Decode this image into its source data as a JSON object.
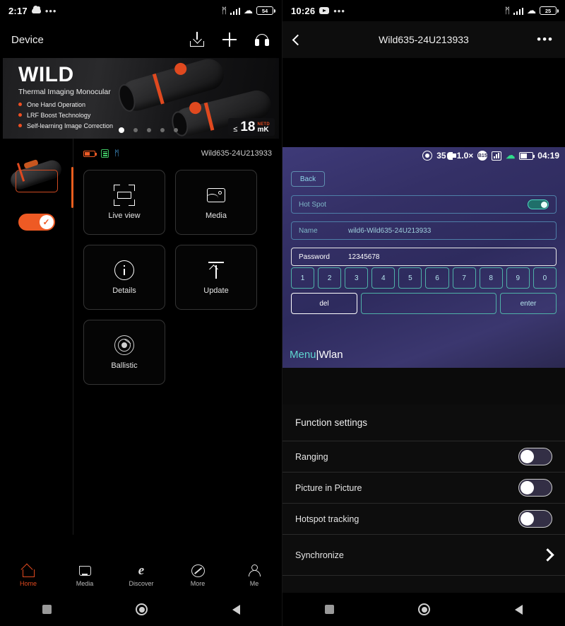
{
  "left": {
    "status": {
      "time": "2:17",
      "cloud_icon": "cloud-icon",
      "dots": "•••",
      "bluetooth": "ᛗ",
      "wifi": "◠",
      "battery": "54"
    },
    "header": {
      "title": "Device",
      "download_label": "download-icon",
      "add_label": "plus-icon",
      "support_label": "headset-icon"
    },
    "banner": {
      "title": "WILD",
      "subtitle": "Thermal Imaging Monocular",
      "features": [
        "One Hand Operation",
        "LRF Boost Technology",
        "Self-learning Image Correction"
      ],
      "netd_le": "≤",
      "netd_value": "18",
      "netd_unit_top": "NETD",
      "netd_unit": "mK",
      "dot_count": 5,
      "active_dot": 0
    },
    "device": {
      "id": "Wild635-24U213933",
      "battery_icon": "battery-icon",
      "storage_icon": "sd-card-icon",
      "bluetooth_icon": "bluetooth-icon",
      "toggle_on": true
    },
    "cards": [
      {
        "label": "Live view",
        "icon": "live-view-icon"
      },
      {
        "label": "Media",
        "icon": "media-icon"
      },
      {
        "label": "Details",
        "icon": "info-icon"
      },
      {
        "label": "Update",
        "icon": "upload-icon"
      },
      {
        "label": "Ballistic",
        "icon": "radar-icon"
      }
    ],
    "tabs": [
      {
        "label": "Home",
        "icon": "home-icon",
        "active": true
      },
      {
        "label": "Media",
        "icon": "folder-icon",
        "active": false
      },
      {
        "label": "Discover",
        "icon": "compass-icon",
        "active": false
      },
      {
        "label": "More",
        "icon": "slash-circle-icon",
        "active": false
      },
      {
        "label": "Me",
        "icon": "person-icon",
        "active": false
      }
    ],
    "sysnav": {
      "recents": "square-icon",
      "home": "circle-icon",
      "back": "triangle-back-icon"
    }
  },
  "right": {
    "status": {
      "time": "10:26",
      "app_icon": "youtube-icon",
      "dots": "•••",
      "bluetooth": "ᛗ",
      "battery": "25"
    },
    "header": {
      "back": "back-chevron-icon",
      "title": "Wild635-24U213933",
      "more": "•••"
    },
    "viewer": {
      "overlay": {
        "target_icon": "target-icon",
        "distance": "35",
        "flag_icon": "flag-icon",
        "zoom": "1.0×",
        "badge": "B15",
        "chart_icon": "histogram-icon",
        "wifi_icon": "wifi-icon",
        "battery_icon": "battery-icon",
        "clock": "04:19"
      },
      "back_label": "Back",
      "rows": [
        {
          "label": "Hot Spot",
          "value": "",
          "type": "toggle",
          "on": true,
          "active": false
        },
        {
          "label": "Name",
          "value": "wild6-Wild635-24U213933",
          "type": "text",
          "active": false
        },
        {
          "label": "Password",
          "value": "12345678",
          "type": "text",
          "active": true
        }
      ],
      "keys": [
        "1",
        "2",
        "3",
        "4",
        "5",
        "6",
        "7",
        "8",
        "9",
        "0"
      ],
      "key_del": "del",
      "key_space": "",
      "key_enter": "enter",
      "breadcrumb_root": "Menu",
      "breadcrumb_sep": "|",
      "breadcrumb_leaf": "Wlan"
    },
    "settings": {
      "section_title": "Function settings",
      "rows": [
        {
          "label": "Ranging",
          "type": "toggle",
          "on": false
        },
        {
          "label": "Picture in Picture",
          "type": "toggle",
          "on": false
        },
        {
          "label": "Hotspot tracking",
          "type": "toggle",
          "on": false
        },
        {
          "label": "Synchronize",
          "type": "chevron"
        }
      ]
    }
  },
  "colors": {
    "accent": "#e0491f",
    "teal": "#4fb0a8",
    "purple_bg": "#343066",
    "green": "#2fdc8a"
  }
}
